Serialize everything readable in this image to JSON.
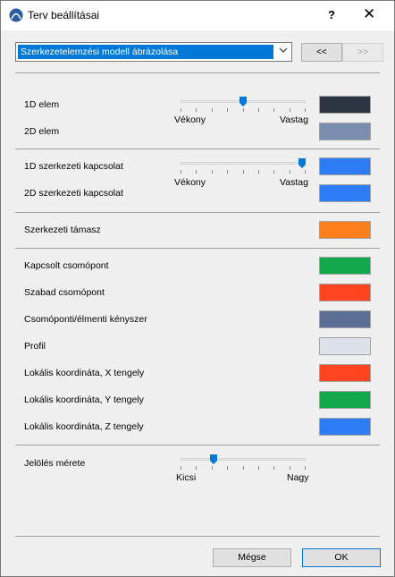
{
  "window": {
    "title": "Terv beállításai",
    "help": "?",
    "close": "✕"
  },
  "toolbar": {
    "dropdown_value": "Szerkezetelemzési modell ábrázolása",
    "prev_label": "<<",
    "next_label": ">>"
  },
  "elements": {
    "e1d_label": "1D elem",
    "e1d_color": "#2e3542",
    "e2d_label": "2D elem",
    "e2d_color": "#7a8fb0",
    "thickness_min": "Vékony",
    "thickness_max": "Vastag",
    "thickness_level": 0.5
  },
  "links": {
    "l1d_label": "1D szerkezeti kapcsolat",
    "l1d_color": "#2d7cf6",
    "l2d_label": "2D szerkezeti kapcsolat",
    "l2d_color": "#2d7cf6",
    "thickness_min": "Vékony",
    "thickness_max": "Vastag",
    "thickness_level": 1.0
  },
  "support": {
    "label": "Szerkezeti támasz",
    "color": "#fd7f1b"
  },
  "nodes": {
    "items": [
      {
        "label": "Kapcsolt csomópont",
        "color": "#13a84c"
      },
      {
        "label": "Szabad csomópont",
        "color": "#fe4520"
      },
      {
        "label": "Csomóponti/élmenti kényszer",
        "color": "#5b6e94"
      },
      {
        "label": "Profil",
        "color": "#dde2ea"
      },
      {
        "label": "Lokális koordináta, X tengely",
        "color": "#fe4520"
      },
      {
        "label": "Lokális koordináta, Y tengely",
        "color": "#13a84c"
      },
      {
        "label": "Lokális koordináta, Z tengely",
        "color": "#2d7cf6"
      }
    ]
  },
  "marker": {
    "label": "Jelölés mérete",
    "min": "Kicsi",
    "max": "Nagy",
    "level": 0.25
  },
  "footer": {
    "cancel_label": "Mégse",
    "ok_label": "OK"
  },
  "colors": {
    "accent": "#0078d7",
    "slider_thumb": "#0078d7"
  }
}
